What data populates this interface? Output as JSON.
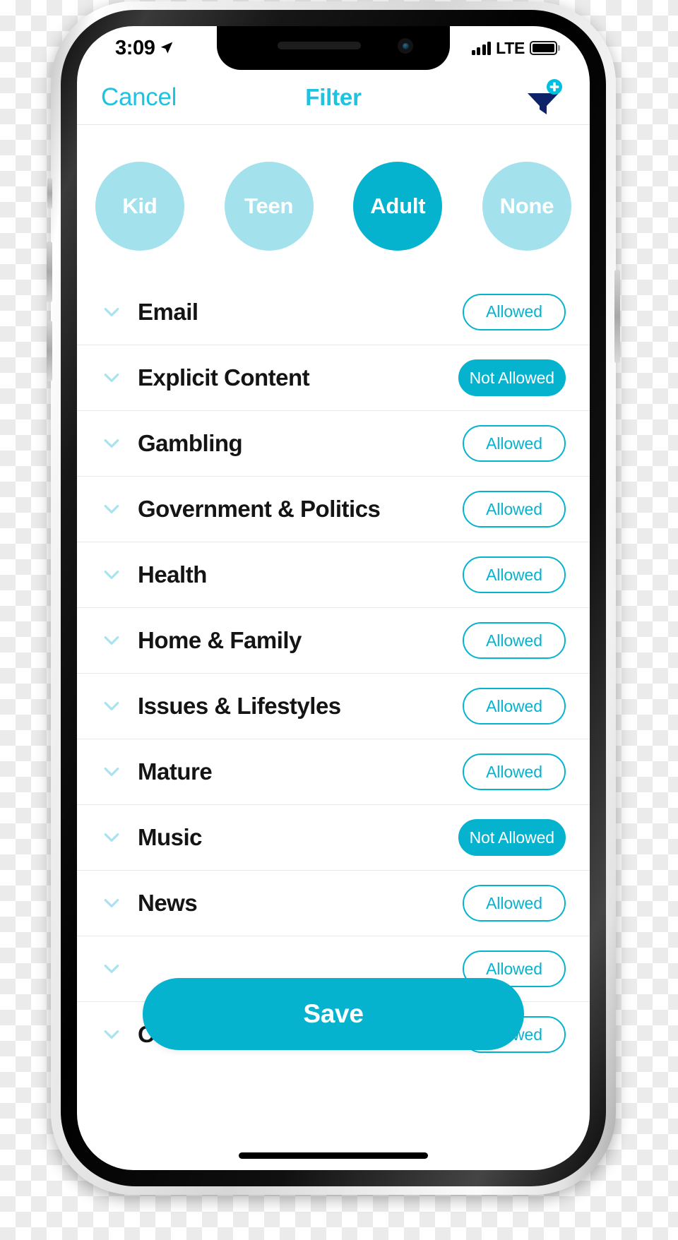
{
  "status_bar": {
    "time": "3:09",
    "location_icon": "location-arrow-icon",
    "signal_icon": "cellular-signal-icon",
    "network": "LTE",
    "battery_icon": "battery-full-icon"
  },
  "nav": {
    "cancel_label": "Cancel",
    "title": "Filter",
    "filter_icon": "funnel-add-icon"
  },
  "age_groups": [
    {
      "label": "Kid",
      "selected": false
    },
    {
      "label": "Teen",
      "selected": false
    },
    {
      "label": "Adult",
      "selected": true
    },
    {
      "label": "None",
      "selected": false
    }
  ],
  "categories": [
    {
      "label": "Email",
      "status": "Allowed",
      "denied": false
    },
    {
      "label": "Explicit Content",
      "status": "Not Allowed",
      "denied": true
    },
    {
      "label": "Gambling",
      "status": "Allowed",
      "denied": false
    },
    {
      "label": "Government & Politics",
      "status": "Allowed",
      "denied": false
    },
    {
      "label": "Health",
      "status": "Allowed",
      "denied": false
    },
    {
      "label": "Home & Family",
      "status": "Allowed",
      "denied": false
    },
    {
      "label": "Issues & Lifestyles",
      "status": "Allowed",
      "denied": false
    },
    {
      "label": "Mature",
      "status": "Allowed",
      "denied": false
    },
    {
      "label": "Music",
      "status": "Not Allowed",
      "denied": true
    },
    {
      "label": "News",
      "status": "Allowed",
      "denied": false
    },
    {
      "label": "",
      "status": "Allowed",
      "denied": false
    },
    {
      "label": "Online Shopping",
      "status": "Allowed",
      "denied": false
    }
  ],
  "save_button": {
    "label": "Save"
  },
  "colors": {
    "accent": "#06B3CE",
    "accent_light": "#A3E2ED",
    "nav_text": "#1FC3E0",
    "filter_icon_navy": "#0D2268",
    "label_text": "#141414",
    "divider": "#E8E8E8"
  }
}
